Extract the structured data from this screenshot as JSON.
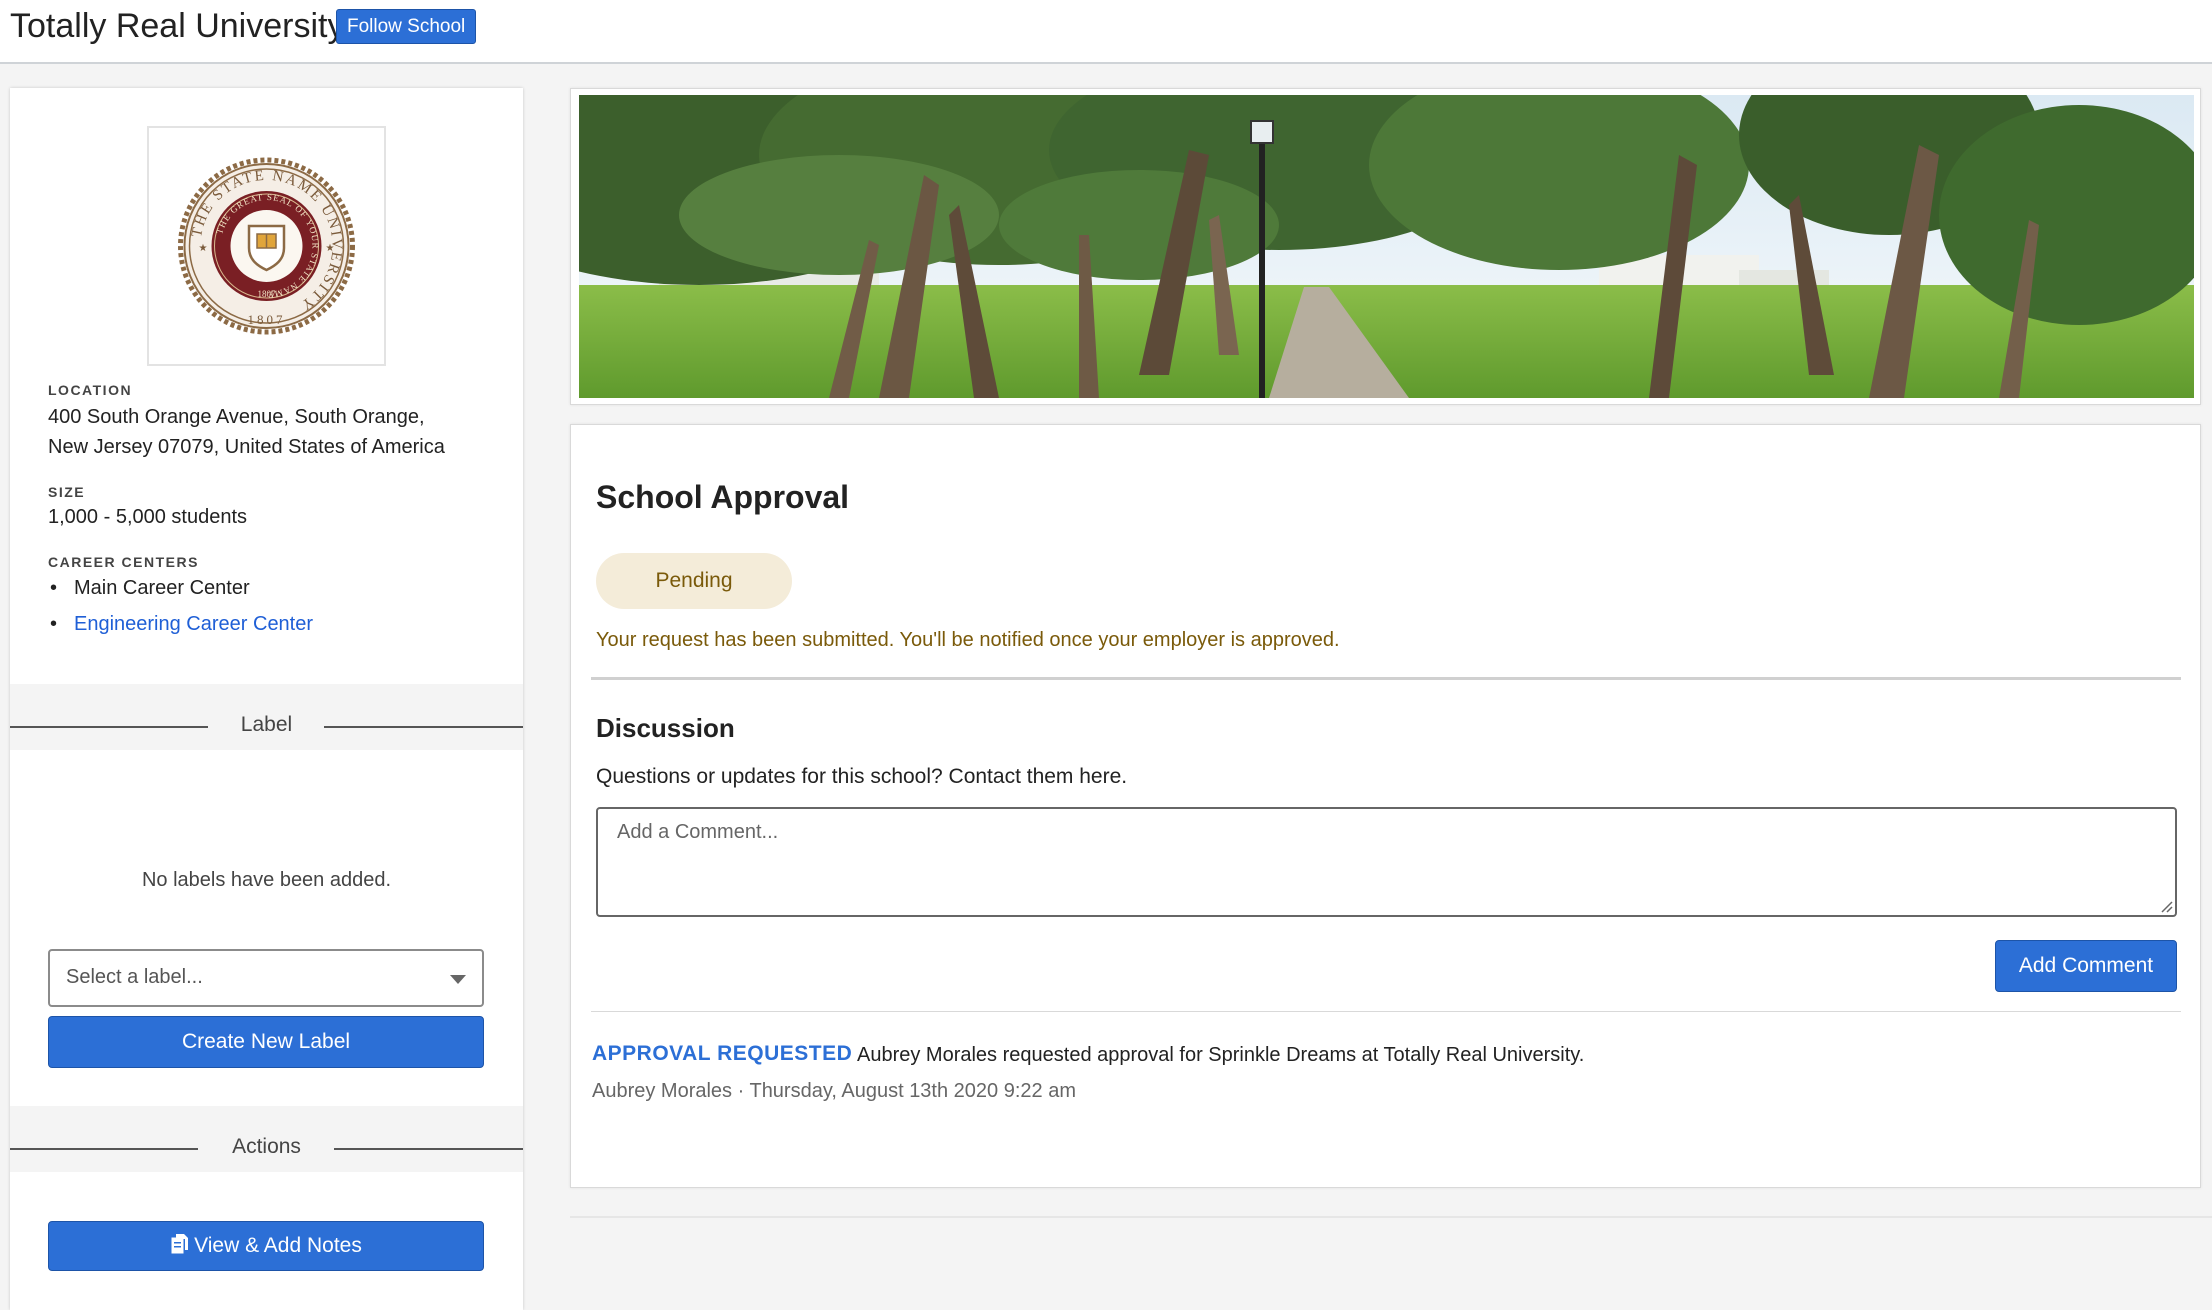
{
  "header": {
    "school_name": "Totally Real University",
    "follow_label": "Follow School"
  },
  "sidebar": {
    "seal": {
      "ring_text": "THE STATE NAME UNIVERSITY",
      "inner_text": "THE GREAT SEAL OF YOUR STATE NAME",
      "year": "1807"
    },
    "location_label": "LOCATION",
    "location_line1": "400 South Orange Avenue, South Orange,",
    "location_line2": "New Jersey 07079, United States of America",
    "size_label": "SIZE",
    "size_value": "1,000 - 5,000 students",
    "career_centers_label": "CAREER CENTERS",
    "career_centers": [
      "Main Career Center",
      "Engineering Career Center"
    ],
    "label_section_title": "Label",
    "no_labels_text": "No labels have been added.",
    "select_placeholder": "Select a label...",
    "create_label_button": "Create New Label",
    "actions_section_title": "Actions",
    "notes_button": "View & Add Notes"
  },
  "approval": {
    "title": "School Approval",
    "status": "Pending",
    "message": "Your request has been submitted. You'll be notified once your employer is approved."
  },
  "discussion": {
    "title": "Discussion",
    "subtitle": "Questions or updates for this school? Contact them here.",
    "comment_placeholder": "Add a Comment...",
    "add_comment_button": "Add Comment"
  },
  "activity": [
    {
      "tag": "APPROVAL REQUESTED",
      "text": "Aubrey Morales requested approval for Sprinkle Dreams at Totally Real University.",
      "meta": "Aubrey Morales · Thursday, August 13th 2020 9:22 am"
    }
  ],
  "colors": {
    "primary": "#2c6fd6",
    "pending_bg": "#f4ecd9",
    "pending_text": "#7a5a0a",
    "link": "#1f5fd6",
    "seal": "#8c6a45"
  },
  "icons": [
    "seal-logo",
    "notes-icon",
    "dropdown-caret-icon",
    "resize-grip-icon"
  ]
}
